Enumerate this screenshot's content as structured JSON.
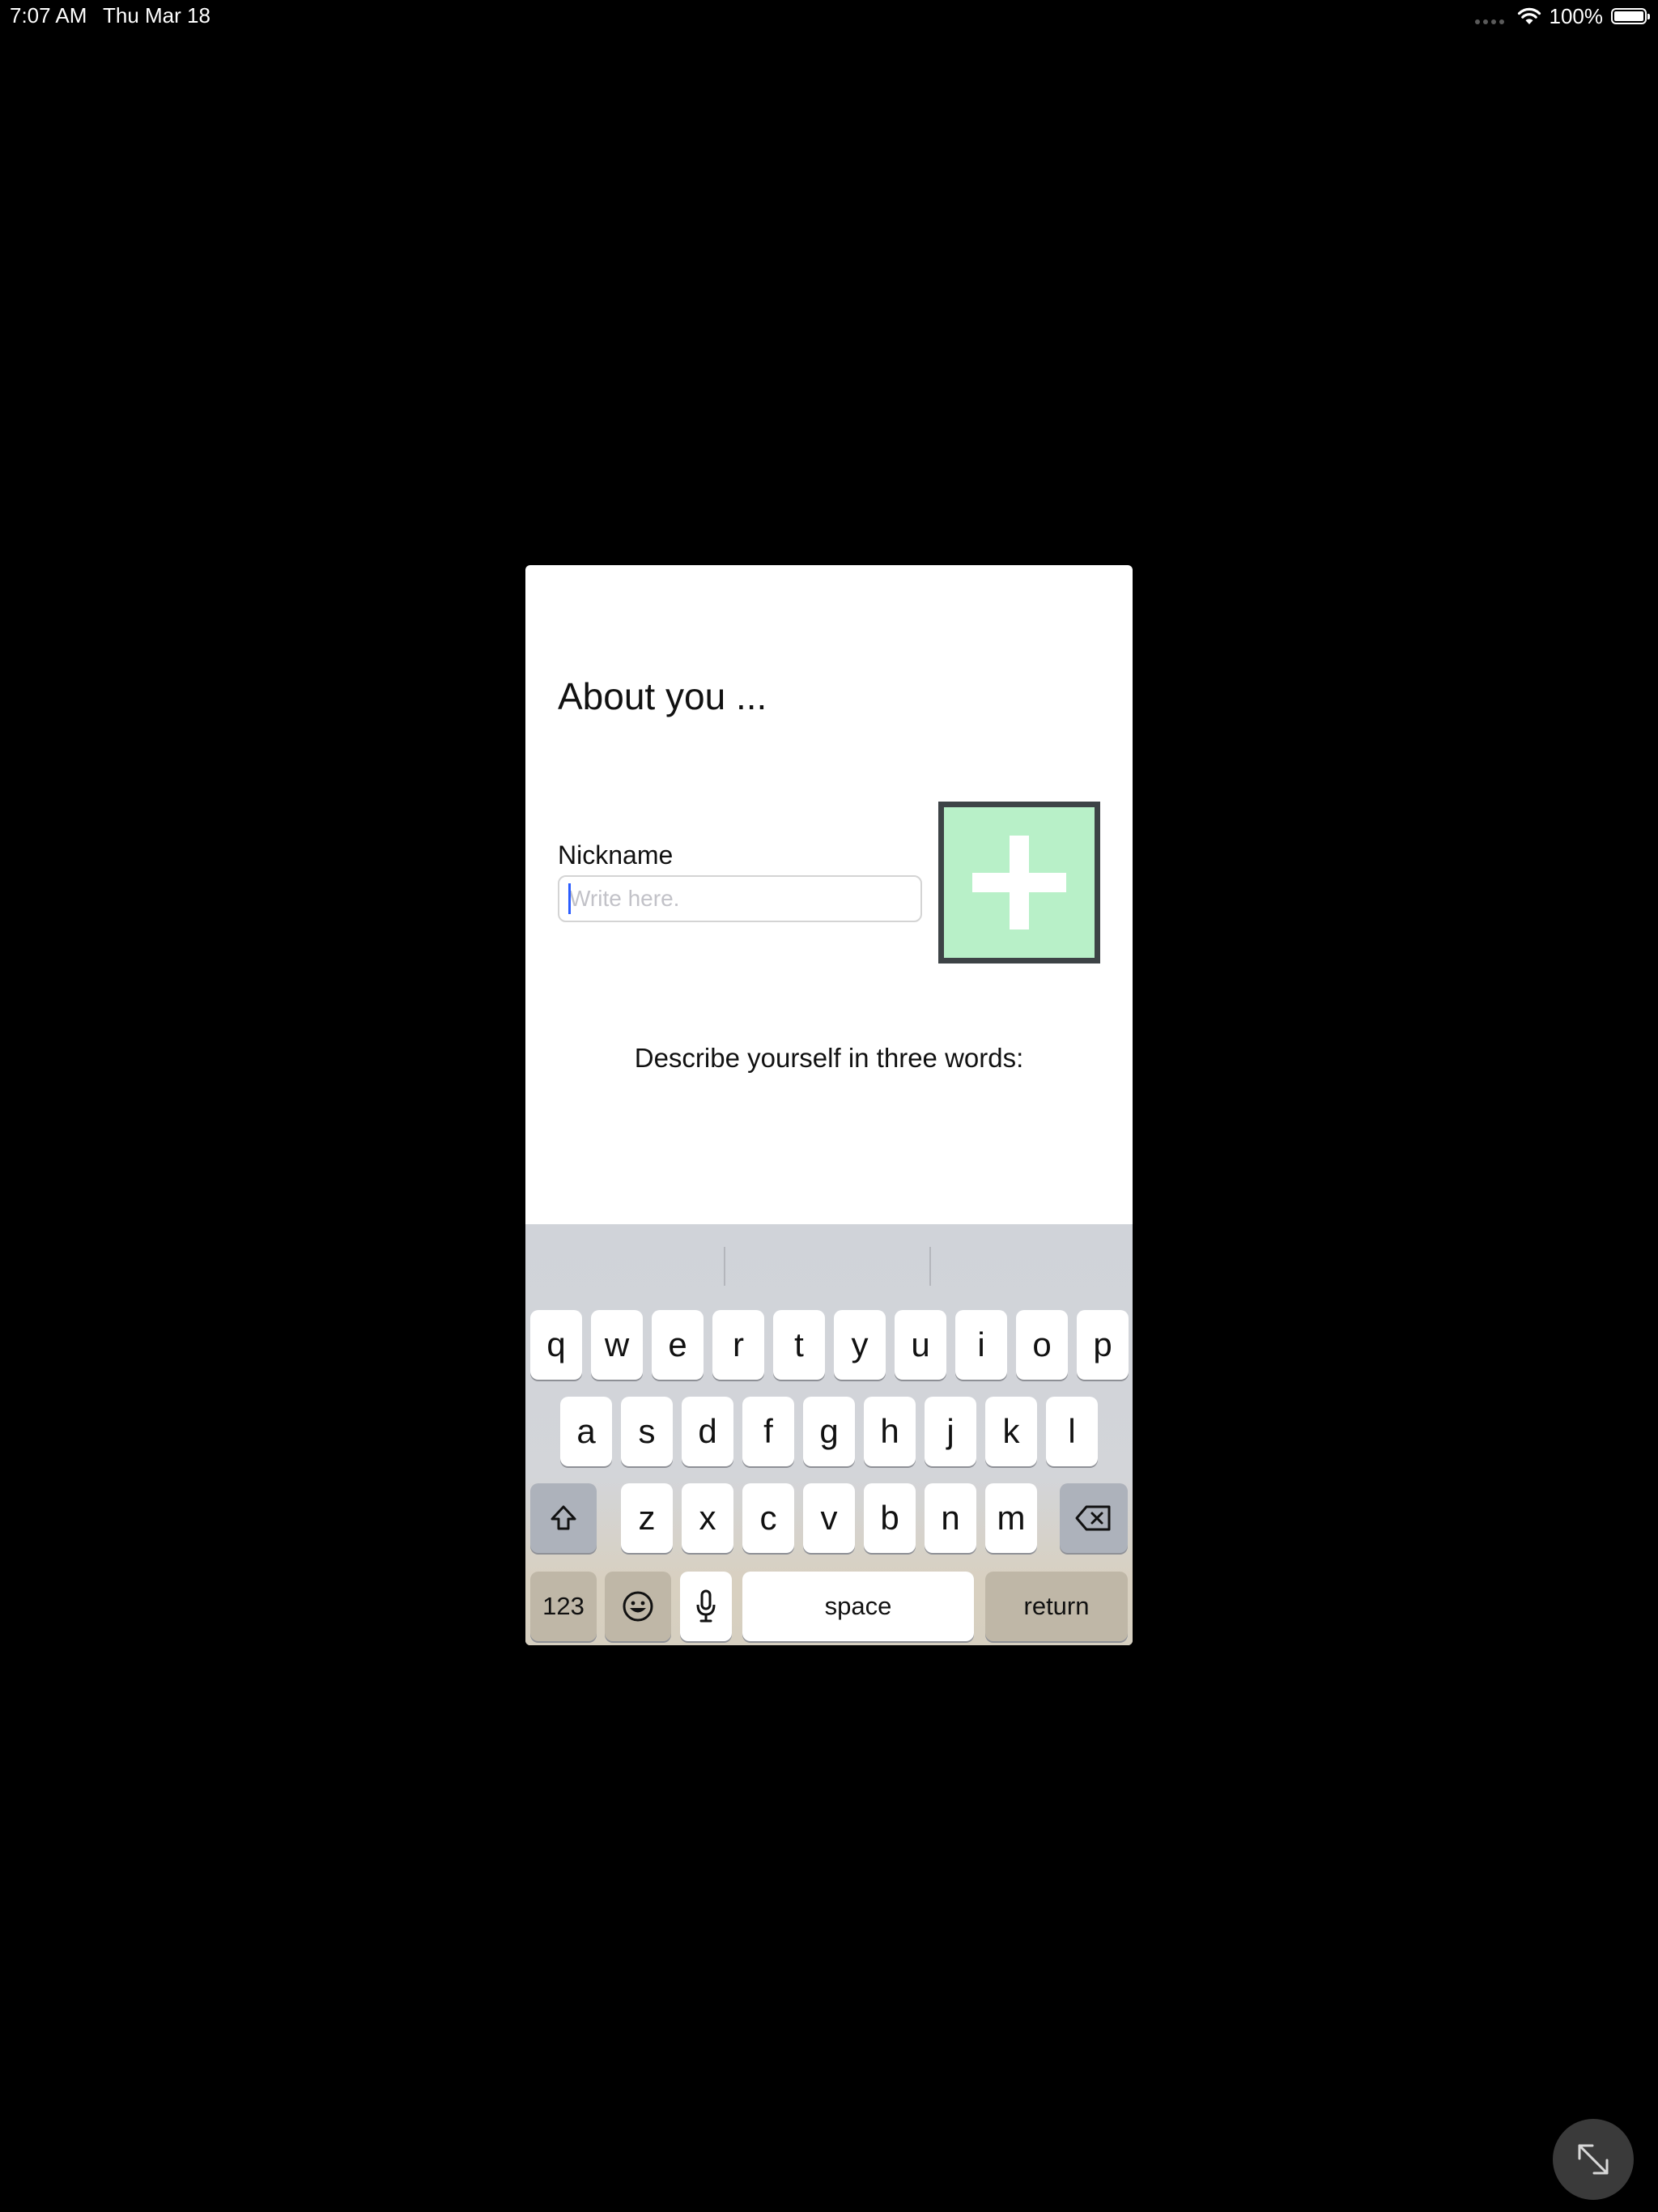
{
  "status_bar": {
    "time": "7:07 AM",
    "date": "Thu Mar 18",
    "battery": "100%",
    "icons": [
      "cellular-dots-icon",
      "wifi-icon",
      "battery-icon"
    ]
  },
  "form": {
    "title": "About you ...",
    "nickname_label": "Nickname",
    "nickname_placeholder": "Write here.",
    "nickname_value": "",
    "add_photo_icon": "plus-icon",
    "describe_prompt": "Describe yourself in three words:"
  },
  "keyboard": {
    "row1": [
      "q",
      "w",
      "e",
      "r",
      "t",
      "y",
      "u",
      "i",
      "o",
      "p"
    ],
    "row2": [
      "a",
      "s",
      "d",
      "f",
      "g",
      "h",
      "j",
      "k",
      "l"
    ],
    "row3": [
      "z",
      "x",
      "c",
      "v",
      "b",
      "n",
      "m"
    ],
    "numbers_label": "123",
    "space_label": "space",
    "return_label": "return",
    "icons": [
      "shift-icon",
      "backspace-icon",
      "emoji-icon",
      "microphone-icon"
    ]
  },
  "overlay": {
    "expand_icon": "expand-arrows-icon"
  },
  "colors": {
    "background": "#000000",
    "add_photo_fill": "#b8f0c8",
    "add_photo_border": "#3d4346",
    "caret": "#2a5cff"
  }
}
